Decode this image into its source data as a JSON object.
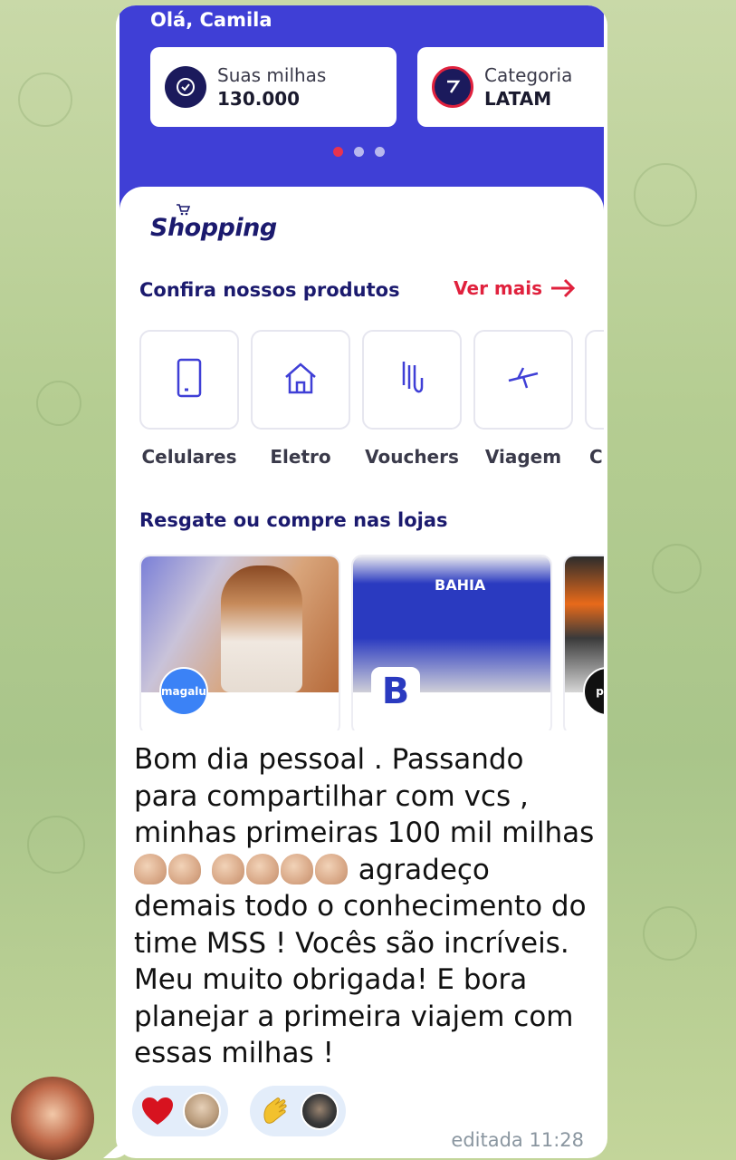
{
  "app": {
    "greeting": "Olá, Camila",
    "cards": [
      {
        "label": "Suas milhas",
        "value": "130.000",
        "icon": "miles-icon"
      },
      {
        "label": "Categoria",
        "value": "LATAM",
        "icon": "category-icon"
      }
    ],
    "carousel_dots": 3,
    "shopping_logo": "Shopping",
    "products_title": "Confira nossos produtos",
    "see_more": "Ver mais",
    "categories": [
      {
        "label": "Celulares",
        "icon": "phone-icon"
      },
      {
        "label": "Eletro",
        "icon": "home-icon"
      },
      {
        "label": "Vouchers",
        "icon": "voucher-icon"
      },
      {
        "label": "Viagem",
        "icon": "plane-icon"
      },
      {
        "label": "C",
        "icon": ""
      }
    ],
    "stores_title": "Resgate ou compre nas lojas",
    "stores": [
      {
        "logo": "magalu"
      },
      {
        "logo": "B",
        "sign": "BAHIA"
      },
      {
        "logo": "pon"
      }
    ]
  },
  "message": {
    "line1": "Bom dia pessoal . Passando para compartilhar com vcs , minhas primeiras 100 mil milhas",
    "line2": "agradeço demais todo o conhecimento do time MSS ! Vocês são incríveis. Meu muito obrigada! E bora planejar a primeira viajem com essas milhas !",
    "reactions": [
      {
        "emoji": "heart",
        "count_avatars": 1
      },
      {
        "emoji": "clap",
        "count_avatars": 1
      }
    ],
    "timestamp": "editada 11:28"
  },
  "colors": {
    "app_blue": "#3f3fd6",
    "navy": "#1b1a6e",
    "accent_red": "#e0213d",
    "reaction_bg": "#e3edfa"
  }
}
